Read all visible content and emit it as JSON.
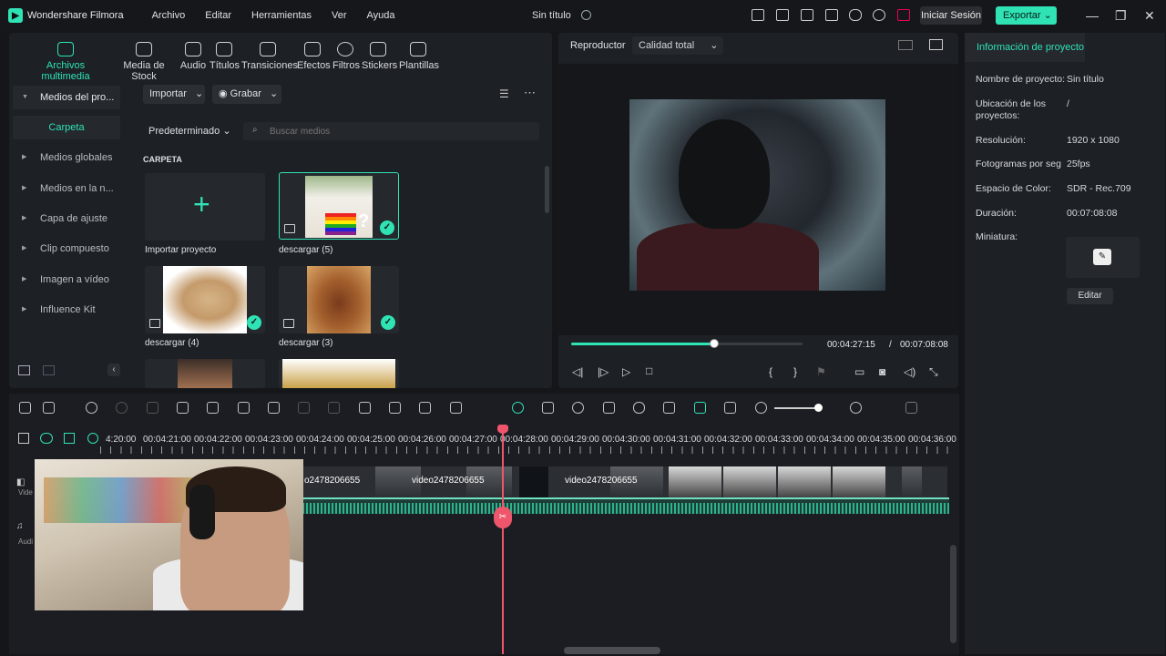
{
  "app": {
    "name": "Wondershare Filmora",
    "menu": [
      "Archivo",
      "Editar",
      "Herramientas",
      "Ver",
      "Ayuda"
    ],
    "document_title": "Sin título",
    "login_label": "Iniciar Sesión",
    "export_label": "Exportar",
    "accent": "#2fe3b5"
  },
  "media": {
    "tools": [
      {
        "label": "Archivos multimedia",
        "icon": "media-icon",
        "active": true
      },
      {
        "label": "Media de Stock",
        "icon": "stock-icon"
      },
      {
        "label": "Audio",
        "icon": "audio-icon"
      },
      {
        "label": "Títulos",
        "icon": "titles-icon"
      },
      {
        "label": "Transiciones",
        "icon": "transitions-icon"
      },
      {
        "label": "Efectos",
        "icon": "effects-icon"
      },
      {
        "label": "Filtros",
        "icon": "filters-icon"
      },
      {
        "label": "Stickers",
        "icon": "stickers-icon"
      },
      {
        "label": "Plantillas",
        "icon": "templates-icon"
      }
    ],
    "sidebar": [
      "Medios del pro...",
      "Carpeta",
      "Medios globales",
      "Medios en la n...",
      "Capa de ajuste",
      "Clip compuesto",
      "Imagen a vídeo",
      "Influence Kit"
    ],
    "import_label": "Importar",
    "record_label": "Grabar",
    "sort_label": "Predeterminado",
    "search_placeholder": "Buscar medios",
    "folder_heading": "CARPETA",
    "items": [
      {
        "label": "Importar proyecto"
      },
      {
        "label": "descargar (5)",
        "selected": true
      },
      {
        "label": "descargar (4)"
      },
      {
        "label": "descargar (3)"
      }
    ]
  },
  "player": {
    "tab": "Reproductor",
    "quality": "Calidad total",
    "current_time": "00:04:27:15",
    "separator": "/",
    "total_time": "00:07:08:08",
    "progress_fraction": 0.62
  },
  "info": {
    "tab": "Información de proyecto",
    "fields": [
      {
        "label": "Nombre de proyecto:",
        "value": "Sin título"
      },
      {
        "label": "Ubicación de los proyectos:",
        "value": "/"
      },
      {
        "label": "Resolución:",
        "value": "1920 x 1080"
      },
      {
        "label": "Fotogramas por seg",
        "value": "25fps"
      },
      {
        "label": "Espacio de Color:",
        "value": "SDR - Rec.709"
      },
      {
        "label": "Duración:",
        "value": "00:07:08:08"
      },
      {
        "label": "Miniatura:",
        "value": ""
      }
    ],
    "edit_label": "Editar"
  },
  "timeline": {
    "ruler_labels": [
      "4:20:00",
      "00:04:21:00",
      "00:04:22:00",
      "00:04:23:00",
      "00:04:24:00",
      "00:04:25:00",
      "00:04:26:00",
      "00:04:27:00",
      "00:04:28:00",
      "00:04:29:00",
      "00:04:30:00",
      "00:04:31:00",
      "00:04:32:00",
      "00:04:33:00",
      "00:04:34:00",
      "00:04:35:00",
      "00:04:36:00"
    ],
    "clip_titles": [
      "o2478206655",
      "video2478206655",
      "video2478206655"
    ],
    "track_labels": [
      "Vide",
      "Audi"
    ]
  }
}
